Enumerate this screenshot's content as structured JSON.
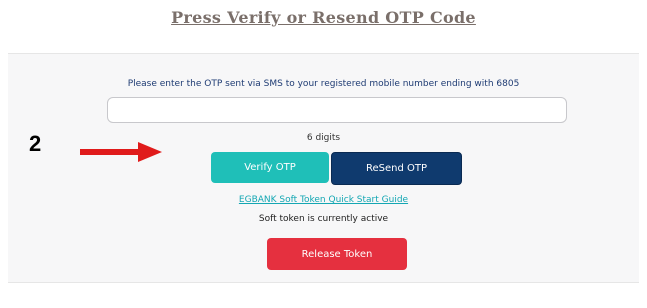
{
  "page_heading": "Press Verify or Resend OTP Code",
  "step_number": "2",
  "otp_form": {
    "instruction": "Please enter the OTP sent via SMS to your registered mobile number ending with 6805",
    "otp_input_value": "",
    "digits_hint": "6 digits",
    "verify_label": "Verify OTP",
    "resend_label": "ReSend OTP",
    "guide_link": "EGBANK Soft Token Quick Start Guide",
    "token_status": "Soft token is currently active",
    "release_label": "Release Token"
  },
  "colors": {
    "verify": "#1fbfb8",
    "resend": "#0f3a6e",
    "release": "#e5303f",
    "arrow": "#e01b1b",
    "link": "#14a7b3"
  },
  "icons": {
    "pointer_arrow": "right-arrow-icon"
  }
}
